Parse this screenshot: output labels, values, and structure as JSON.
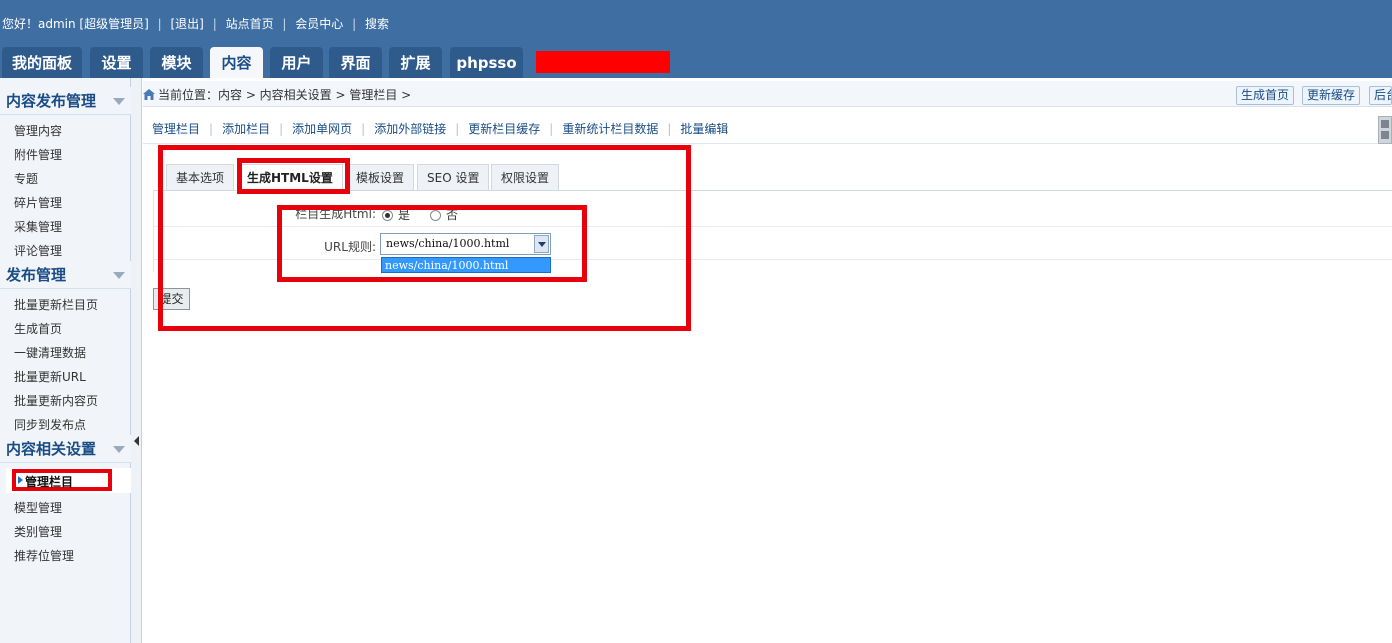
{
  "topbar": {
    "greeting": "您好！admin [超级管理员]",
    "logout": "[退出]",
    "site_home": "站点首页",
    "member_center": "会员中心",
    "search": "搜索"
  },
  "nav_tabs": [
    "我的面板",
    "设置",
    "模块",
    "内容",
    "用户",
    "界面",
    "扩展",
    "phpsso"
  ],
  "nav_active": "内容",
  "sidebar": {
    "sections": [
      {
        "title": "内容发布管理",
        "items": [
          "管理内容",
          "附件管理",
          "专题",
          "碎片管理",
          "采集管理",
          "评论管理"
        ]
      },
      {
        "title": "发布管理",
        "items": [
          "批量更新栏目页",
          "生成首页",
          "一键清理数据",
          "批量更新URL",
          "批量更新内容页",
          "同步到发布点"
        ]
      },
      {
        "title": "内容相关设置",
        "items": [
          "管理栏目",
          "模型管理",
          "类别管理",
          "推荐位管理"
        ]
      }
    ],
    "active_item": "管理栏目"
  },
  "breadcrumb": "当前位置：内容 > 内容相关设置 > 管理栏目 >",
  "top_buttons": [
    "生成首页",
    "更新缓存",
    "后台"
  ],
  "subnav": [
    "管理栏目",
    "添加栏目",
    "添加单网页",
    "添加外部链接",
    "更新栏目缓存",
    "重新统计栏目数据",
    "批量编辑"
  ],
  "form_tabs": [
    "基本选项",
    "生成HTML设置",
    "模板设置",
    "SEO 设置",
    "权限设置"
  ],
  "form_tab_active": "生成HTML设置",
  "form": {
    "html_label": "栏目生成Html:",
    "radio_yes": "是",
    "radio_no": "否",
    "radio_selected": "是",
    "url_label": "URL规则:",
    "url_value": "news/china/1000.html",
    "url_options": [
      "news/china/1000.html"
    ],
    "submit_label": "提交"
  },
  "colors": {
    "header_bg": "#3f6ea3",
    "tab_bg": "#2f5a8c",
    "annotation_red": "#e8000b",
    "selected_option": "#3399ff"
  },
  "icons": [
    "home-icon",
    "collapse-arrow-icon",
    "chevron-down-icon",
    "pointer-arrow-icon"
  ]
}
